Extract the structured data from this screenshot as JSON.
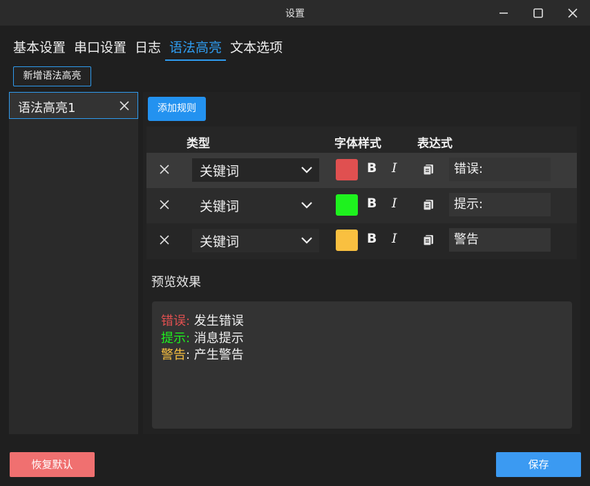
{
  "window": {
    "title": "设置"
  },
  "tabs": [
    {
      "label": "基本设置"
    },
    {
      "label": "串口设置"
    },
    {
      "label": "日志"
    },
    {
      "label": "语法高亮",
      "active": true
    },
    {
      "label": "文本选项"
    }
  ],
  "sidebar": {
    "new_button": "新增语法高亮",
    "items": [
      {
        "label": "语法高亮1"
      }
    ]
  },
  "rules": {
    "add_button": "添加规则",
    "headers": {
      "type": "类型",
      "font_style": "字体样式",
      "expression": "表达式"
    },
    "rows": [
      {
        "type": "关键词",
        "color": "#e05050",
        "bold_label": "B",
        "italic_label": "I",
        "expression": "错误:"
      },
      {
        "type": "关键词",
        "color": "#1ef21e",
        "bold_label": "B",
        "italic_label": "I",
        "expression": "提示:"
      },
      {
        "type": "关键词",
        "color": "#f9c040",
        "bold_label": "B",
        "italic_label": "I",
        "expression": "警告"
      }
    ]
  },
  "preview": {
    "label": "预览效果",
    "lines": [
      {
        "keyword": "错误:",
        "keyword_color": "#e05050",
        "text": " 发生错误"
      },
      {
        "keyword": "提示:",
        "keyword_color": "#1ef21e",
        "text": " 消息提示"
      },
      {
        "keyword": "警告",
        "keyword_color": "#f9c040",
        "text": ": 产生警告"
      }
    ]
  },
  "footer": {
    "reset_button": "恢复默认",
    "save_button": "保存"
  },
  "icons": {
    "minimize": "minimize-icon",
    "maximize": "maximize-icon",
    "close": "close-icon",
    "delete": "close-icon",
    "dropdown": "chevron-down-icon",
    "copy": "copy-icon"
  }
}
